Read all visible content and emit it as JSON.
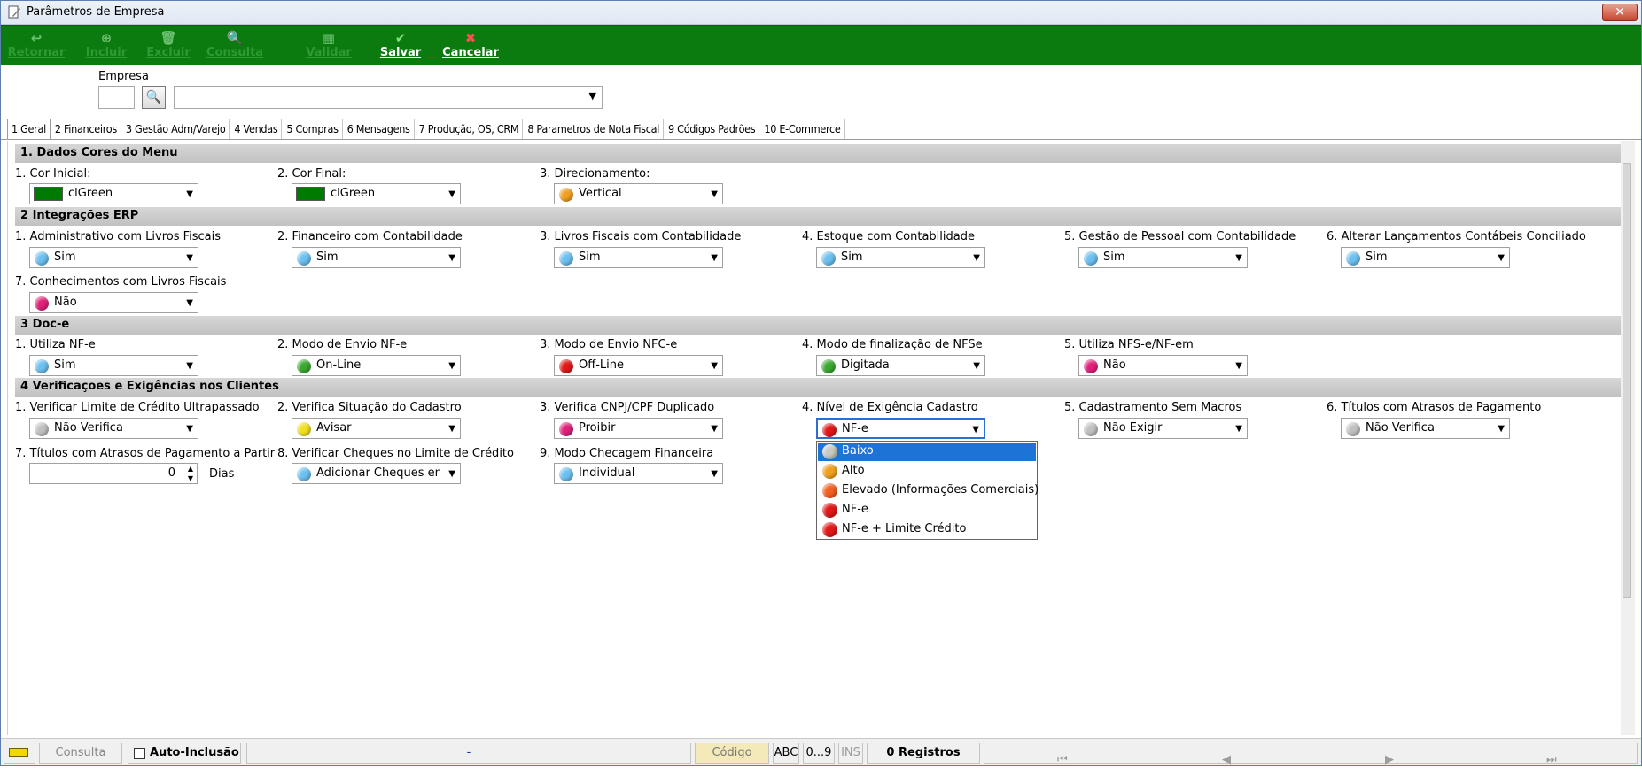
{
  "window": {
    "title": "Parâmetros de Empresa",
    "close_glyph": "✕"
  },
  "toolbar": {
    "retornar": "Retornar",
    "incluir": "Incluir",
    "excluir": "Excluir",
    "consulta": "Consulta",
    "validar": "Validar",
    "salvar": "Salvar",
    "cancelar": "Cancelar"
  },
  "empresa": {
    "label": "Empresa",
    "code_value": "",
    "name_value": ""
  },
  "tabs": [
    "1 Geral",
    "2 Financeiros",
    "3 Gestão Adm/Varejo",
    "4 Vendas",
    "5 Compras",
    "6 Mensagens",
    "7 Produção, OS, CRM",
    "8 Parametros de Nota Fiscal",
    "9 Códigos Padrões",
    "10 E-Commerce"
  ],
  "sections": {
    "s1": "1.  Dados Cores do Menu",
    "s2": "2 Integrações ERP",
    "s3": "3  Doc-e",
    "s4": "4 Verificações e Exigências nos Clientes"
  },
  "fields": {
    "cor_inicial": {
      "label": "1. Cor Inicial:",
      "value": "clGreen",
      "color": "#007a00"
    },
    "cor_final": {
      "label": "2. Cor Final:",
      "value": "clGreen",
      "color": "#007a00"
    },
    "direcionamento": {
      "label": "3. Direcionamento:",
      "value": "Vertical",
      "color": "#f0a020"
    },
    "adm_livros": {
      "label": "1. Administrativo com Livros Fiscais",
      "value": "Sim",
      "color": "#6cc0f0"
    },
    "fin_contab": {
      "label": "2. Financeiro com Contabilidade",
      "value": "Sim",
      "color": "#6cc0f0"
    },
    "livros_contab": {
      "label": "3. Livros Fiscais com Contabilidade",
      "value": "Sim",
      "color": "#6cc0f0"
    },
    "estoque_contab": {
      "label": "4. Estoque com Contabilidade",
      "value": "Sim",
      "color": "#6cc0f0"
    },
    "pessoal_contab": {
      "label": "5. Gestão de Pessoal com Contabilidade",
      "value": "Sim",
      "color": "#6cc0f0"
    },
    "alterar_lanc": {
      "label": "6. Alterar Lançamentos Contábeis Conciliado",
      "value": "Sim",
      "color": "#6cc0f0"
    },
    "conhec_livros": {
      "label": "7. Conhecimentos com Livros Fiscais",
      "value": "Não",
      "color": "#e0207a"
    },
    "utiliza_nfe": {
      "label": "1. Utiliza NF-e",
      "value": "Sim",
      "color": "#6cc0f0"
    },
    "modo_nfe": {
      "label": "2. Modo de Envio NF-e",
      "value": "On-Line",
      "color": "#3aa830"
    },
    "modo_nfce": {
      "label": "3. Modo de Envio NFC-e",
      "value": "Off-Line",
      "color": "#e01818"
    },
    "modo_nfse": {
      "label": "4. Modo de finalização de NFSe",
      "value": "Digitada",
      "color": "#3aa830"
    },
    "utiliza_nfse": {
      "label": "5. Utiliza NFS-e/NF-em",
      "value": "Não",
      "color": "#e0207a"
    },
    "limite_credito": {
      "label": "1. Verificar Limite de Crédito Ultrapassado",
      "value": "Não Verifica",
      "color": "#c0c0c0"
    },
    "situacao_cad": {
      "label": "2. Verifica Situação do Cadastro",
      "value": "Avisar",
      "color": "#f0e020"
    },
    "cnpj_dup": {
      "label": "3. Verifica CNPJ/CPF Duplicado",
      "value": "Proibir",
      "color": "#e0207a"
    },
    "nivel_exig": {
      "label": "4. Nível de Exigência Cadastro",
      "value": "NF-e",
      "color": "#e01818"
    },
    "sem_macros": {
      "label": "5. Cadastramento Sem Macros",
      "value": "Não Exigir",
      "color": "#c0c0c0"
    },
    "titulos_atraso": {
      "label": "6. Títulos com Atrasos de Pagamento",
      "value": "Não Verifica",
      "color": "#c0c0c0"
    },
    "titulos_partir": {
      "label": "7. Títulos com Atrasos de Pagamento a Partir",
      "value": "0",
      "unit": "Dias"
    },
    "cheques_limite": {
      "label": "8. Verificar Cheques no Limite de Crédito",
      "value": "Adicionar Cheques en",
      "color": "#6cc0f0"
    },
    "checagem_fin": {
      "label": "9. Modo Checagem Financeira",
      "value": "Individual",
      "color": "#6cc0f0"
    }
  },
  "dropdown": {
    "items": [
      {
        "text": "Baixo",
        "color": "#c8c8c8",
        "selected": true
      },
      {
        "text": "Alto",
        "color": "#f0a020"
      },
      {
        "text": "Elevado (Informações Comerciais)",
        "color": "#f06020"
      },
      {
        "text": "NF-e",
        "color": "#e01818"
      },
      {
        "text": "NF-e + Limite Crédito",
        "color": "#e01818"
      }
    ]
  },
  "statusbar": {
    "consulta": "Consulta",
    "auto_inclusao": "Auto-Inclusão",
    "dash": "-",
    "codigo": "Código",
    "abc": "ABC",
    "range": "0...9",
    "ins": "INS",
    "registros": "0 Registros",
    "nav_first": "⏮",
    "nav_prev": "◀",
    "nav_next": "▶",
    "nav_last": "⏭"
  }
}
